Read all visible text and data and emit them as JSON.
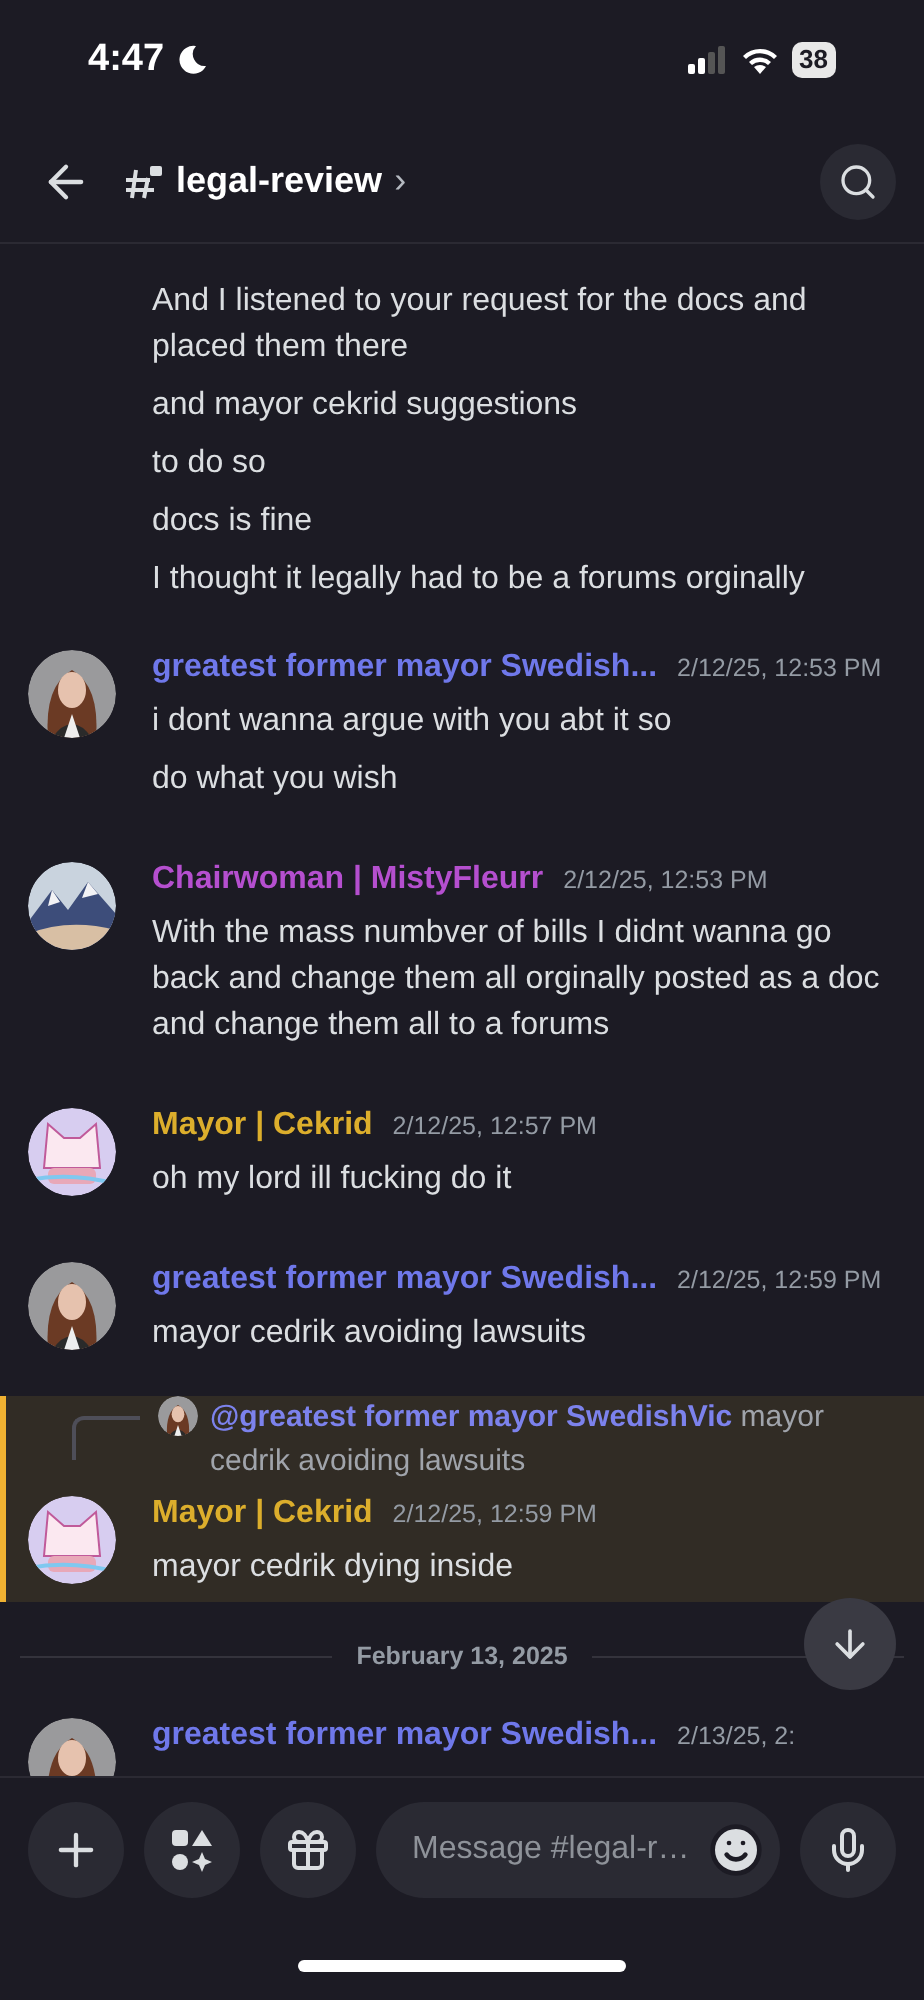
{
  "status_bar": {
    "time": "4:47",
    "battery": "38"
  },
  "header": {
    "channel": "legal-review",
    "chevron": "›"
  },
  "messages": [
    {
      "kind": "continuation",
      "lines": [
        "And I listened to your request for the docs and placed them there",
        "and mayor cekrid suggestions",
        "to do so",
        "docs is fine",
        "I thought it legally had to be a forums orginally"
      ]
    },
    {
      "kind": "message",
      "author": "greatest former mayor Swedish...",
      "color": "#6f78ea",
      "avatar": {
        "kind": "picture"
      },
      "timestamp": "2/12/25, 12:53 PM",
      "lines": [
        "i dont wanna argue with you abt it so",
        "do what you wish"
      ]
    },
    {
      "kind": "message",
      "author": "Chairwoman | MistyFleurr",
      "color": "#b54fcf",
      "avatar": {
        "kind": "picture"
      },
      "timestamp": "2/12/25, 12:53 PM",
      "lines": [
        "With the mass numbver of bills I didnt wanna go back and change them all orginally posted as a doc and change them all to a forums"
      ]
    },
    {
      "kind": "message",
      "author": "Mayor | Cekrid",
      "color": "#dcae2c",
      "avatar": {
        "kind": "picture"
      },
      "timestamp": "2/12/25, 12:57 PM",
      "lines": [
        "oh my lord ill fucking do it"
      ]
    },
    {
      "kind": "message",
      "author": "greatest former mayor Swedish...",
      "color": "#6f78ea",
      "avatar": {
        "kind": "picture"
      },
      "timestamp": "2/12/25, 12:59 PM",
      "lines": [
        "mayor cedrik avoiding lawsuits"
      ]
    },
    {
      "kind": "message",
      "highlighted": true,
      "author": "Mayor | Cekrid",
      "color": "#dcae2c",
      "avatar": {
        "kind": "picture"
      },
      "timestamp": "2/12/25, 12:59 PM",
      "reply": {
        "mention": "@greatest former mayor SwedishVic",
        "text": "mayor cedrik avoiding lawsuits"
      },
      "lines": [
        "mayor cedrik dying inside"
      ]
    },
    {
      "kind": "divider",
      "label": "February 13, 2025"
    },
    {
      "kind": "message",
      "author": "greatest former mayor Swedish...",
      "color": "#6f78ea",
      "avatar": {
        "kind": "picture"
      },
      "timestamp": "2/13/25, 2:"
    }
  ],
  "composer": {
    "placeholder": "Message #legal-r…"
  }
}
